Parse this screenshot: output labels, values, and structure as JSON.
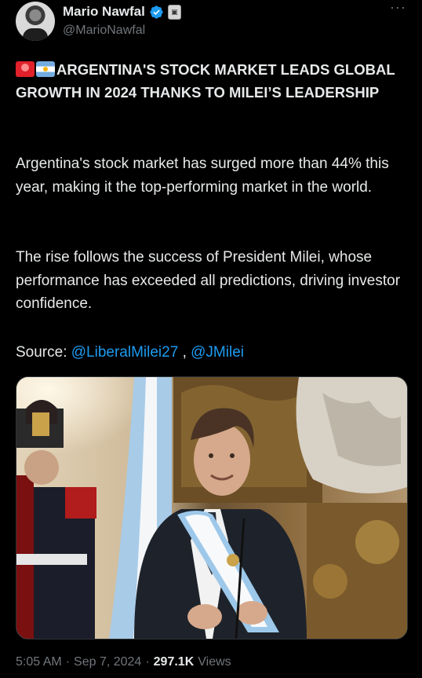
{
  "author": {
    "name": "Mario Nawfal",
    "handle": "@MarioNawfal",
    "verified_color": "#1d9bf0",
    "avatar_icon": "avatar-photo",
    "badge_icon": "organization-badge-icon"
  },
  "tweet": {
    "headline": "ARGENTINA'S STOCK MARKET LEADS GLOBAL GROWTH IN 2024 THANKS TO MILEI’S LEADERSHIP",
    "headline_emojis": [
      "siren-emoji",
      "argentina-flag-emoji"
    ],
    "paragraph1": "Argentina's stock market has surged more than 44% this year, making it the top-performing market in the world.",
    "paragraph2": "The rise follows the success of President Milei, whose performance has exceeded all predictions, driving investor confidence.",
    "source_label": "Source:",
    "mention1": "@LiberalMilei27",
    "separator": ",",
    "mention2": "@JMilei",
    "mention_color": "#1d9bf0"
  },
  "media": {
    "icon": "tweet-photo"
  },
  "meta": {
    "time": "5:05 AM",
    "dot": "·",
    "date": "Sep 7, 2024",
    "views_count": "297.1K",
    "views_label": "Views"
  }
}
